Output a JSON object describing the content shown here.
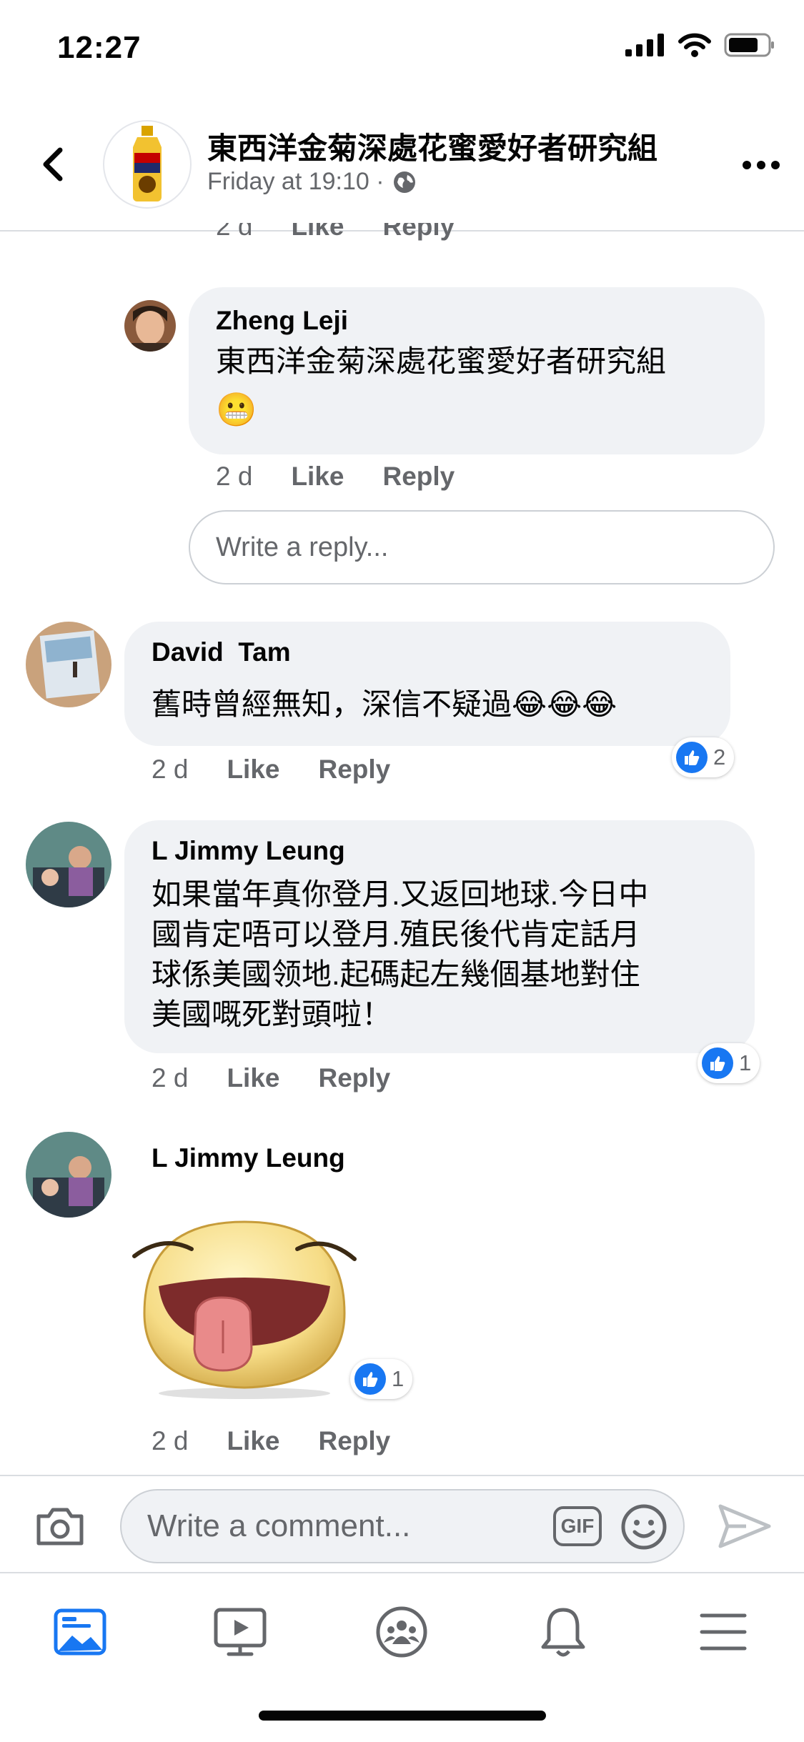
{
  "status": {
    "time": "12:27"
  },
  "header": {
    "title": "東西洋金菊深處花蜜愛好者研究組",
    "subtitle": "Friday at 19:10 ·"
  },
  "comments": [
    {
      "age": "2 d",
      "like": "Like",
      "reply": "Reply"
    },
    {
      "author": "Zheng Leji",
      "text": "東西洋金菊深處花蜜愛好者研究組",
      "emoji": "😬",
      "age": "2 d",
      "like": "Like",
      "reply": "Reply"
    },
    {
      "author": "David  Tam",
      "text": "舊時曾經無知，深信不疑過😂😂😂",
      "age": "2 d",
      "like": "Like",
      "reply": "Reply",
      "reactions": "2"
    },
    {
      "author": "L Jimmy Leung",
      "lines": [
        "如果當年真你登月.又返回地球.今日中",
        "國肯定唔可以登月.殖民後代肯定話月",
        "球係美國领地.起碼起左幾個基地對住",
        "美國嘅死對頭啦！"
      ],
      "age": "2 d",
      "like": "Like",
      "reply": "Reply",
      "reactions": "1"
    },
    {
      "author": "L Jimmy Leung",
      "sticker": "tongue-out-sticker",
      "age": "2 d",
      "like": "Like",
      "reply": "Reply",
      "reactions": "1"
    }
  ],
  "reply_input": {
    "placeholder": "Write a reply..."
  },
  "composer": {
    "placeholder": "Write a comment...",
    "gif": "GIF"
  },
  "tabs": [
    "news-feed-icon",
    "watch-icon",
    "groups-icon",
    "notifications-icon",
    "menu-icon"
  ],
  "colors": {
    "accent": "#1877f2",
    "bubble": "#f0f2f5",
    "secondary_text": "#65676b"
  }
}
